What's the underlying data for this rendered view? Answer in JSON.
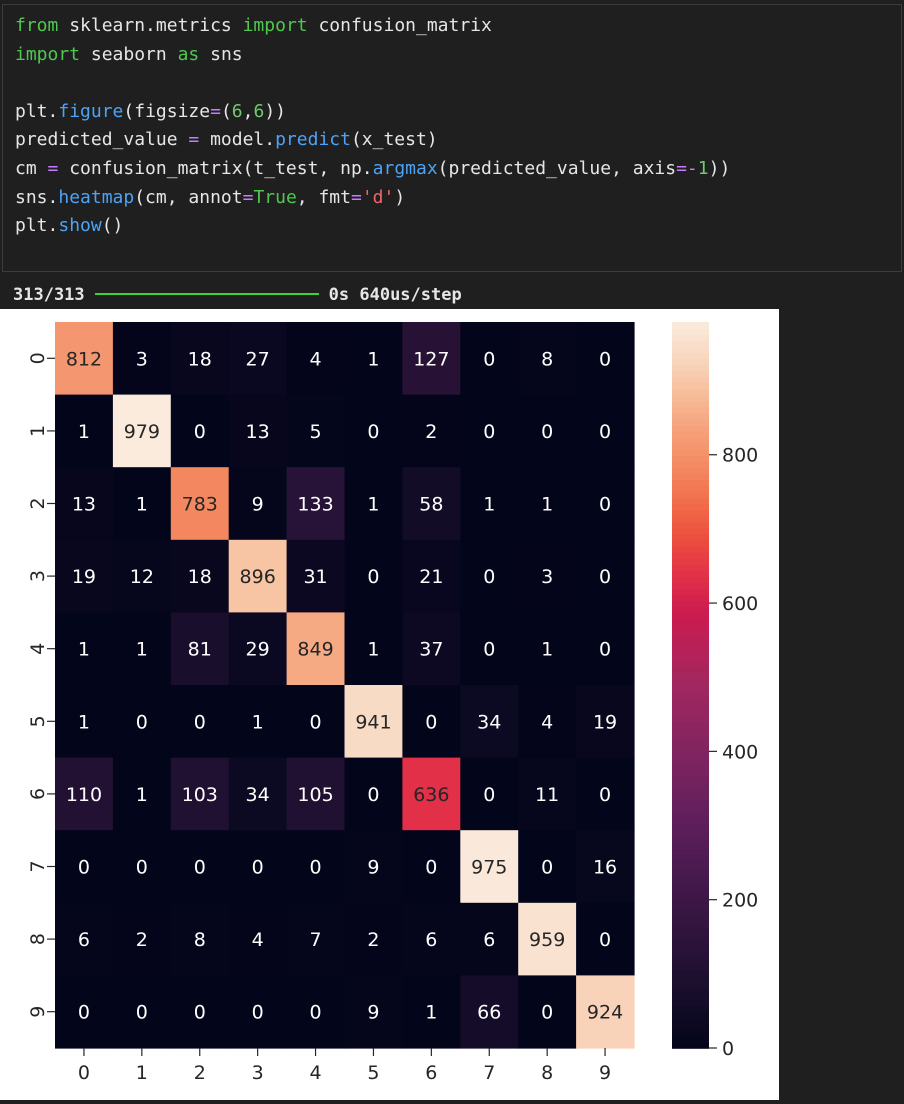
{
  "code_lines": [
    [
      {
        "t": "from",
        "c": "#4ec94e"
      },
      {
        "t": " sklearn.metrics ",
        "c": "#e6e6e6"
      },
      {
        "t": "import",
        "c": "#4ec94e"
      },
      {
        "t": " confusion_matrix",
        "c": "#e6e6e6"
      }
    ],
    [
      {
        "t": "import",
        "c": "#4ec94e"
      },
      {
        "t": " seaborn ",
        "c": "#e6e6e6"
      },
      {
        "t": "as",
        "c": "#4ec94e"
      },
      {
        "t": " sns",
        "c": "#e6e6e6"
      }
    ],
    [],
    [
      {
        "t": "plt.",
        "c": "#e6e6e6"
      },
      {
        "t": "figure",
        "c": "#4da3f5"
      },
      {
        "t": "(figsize",
        "c": "#e6e6e6"
      },
      {
        "t": "=",
        "c": "#c77dff"
      },
      {
        "t": "(",
        "c": "#e6e6e6"
      },
      {
        "t": "6",
        "c": "#6ec96e"
      },
      {
        "t": ",",
        "c": "#e6e6e6"
      },
      {
        "t": "6",
        "c": "#6ec96e"
      },
      {
        "t": "))",
        "c": "#e6e6e6"
      }
    ],
    [
      {
        "t": "predicted_value ",
        "c": "#e6e6e6"
      },
      {
        "t": "=",
        "c": "#c77dff"
      },
      {
        "t": " model.",
        "c": "#e6e6e6"
      },
      {
        "t": "predict",
        "c": "#4da3f5"
      },
      {
        "t": "(x_test)",
        "c": "#e6e6e6"
      }
    ],
    [
      {
        "t": "cm ",
        "c": "#e6e6e6"
      },
      {
        "t": "=",
        "c": "#c77dff"
      },
      {
        "t": " confusion_matrix(t_test, np.",
        "c": "#e6e6e6"
      },
      {
        "t": "argmax",
        "c": "#4da3f5"
      },
      {
        "t": "(predicted_value, axis",
        "c": "#e6e6e6"
      },
      {
        "t": "=-",
        "c": "#c77dff"
      },
      {
        "t": "1",
        "c": "#6ec96e"
      },
      {
        "t": "))",
        "c": "#e6e6e6"
      }
    ],
    [
      {
        "t": "sns.",
        "c": "#e6e6e6"
      },
      {
        "t": "heatmap",
        "c": "#4da3f5"
      },
      {
        "t": "(cm, annot",
        "c": "#e6e6e6"
      },
      {
        "t": "=",
        "c": "#c77dff"
      },
      {
        "t": "True",
        "c": "#4ec94e"
      },
      {
        "t": ", fmt",
        "c": "#e6e6e6"
      },
      {
        "t": "=",
        "c": "#c77dff"
      },
      {
        "t": "'d'",
        "c": "#f06666"
      },
      {
        "t": ")",
        "c": "#e6e6e6"
      }
    ],
    [
      {
        "t": "plt.",
        "c": "#e6e6e6"
      },
      {
        "t": "show",
        "c": "#4da3f5"
      },
      {
        "t": "()",
        "c": "#e6e6e6"
      }
    ]
  ],
  "output": {
    "steps": "313/313",
    "timing": "0s 640us/step"
  },
  "colors": {
    "background": "#1f1f1f",
    "plot_background": "#ffffff",
    "progress": "#3ad43a"
  },
  "chart_data": {
    "type": "heatmap",
    "colormap": "rocket",
    "annot": true,
    "x_ticks": [
      "0",
      "1",
      "2",
      "3",
      "4",
      "5",
      "6",
      "7",
      "8",
      "9"
    ],
    "y_ticks": [
      "0",
      "1",
      "2",
      "3",
      "4",
      "5",
      "6",
      "7",
      "8",
      "9"
    ],
    "matrix": [
      [
        812,
        3,
        18,
        27,
        4,
        1,
        127,
        0,
        8,
        0
      ],
      [
        1,
        979,
        0,
        13,
        5,
        0,
        2,
        0,
        0,
        0
      ],
      [
        13,
        1,
        783,
        9,
        133,
        1,
        58,
        1,
        1,
        0
      ],
      [
        19,
        12,
        18,
        896,
        31,
        0,
        21,
        0,
        3,
        0
      ],
      [
        1,
        1,
        81,
        29,
        849,
        1,
        37,
        0,
        1,
        0
      ],
      [
        1,
        0,
        0,
        1,
        0,
        941,
        0,
        34,
        4,
        19
      ],
      [
        110,
        1,
        103,
        34,
        105,
        0,
        636,
        0,
        11,
        0
      ],
      [
        0,
        0,
        0,
        0,
        0,
        9,
        0,
        975,
        0,
        16
      ],
      [
        6,
        2,
        8,
        4,
        7,
        2,
        6,
        6,
        959,
        0
      ],
      [
        0,
        0,
        0,
        0,
        0,
        9,
        1,
        66,
        0,
        924
      ]
    ],
    "vmin": 0,
    "vmax": 979,
    "colorbar_ticks": [
      0,
      200,
      400,
      600,
      800
    ]
  }
}
